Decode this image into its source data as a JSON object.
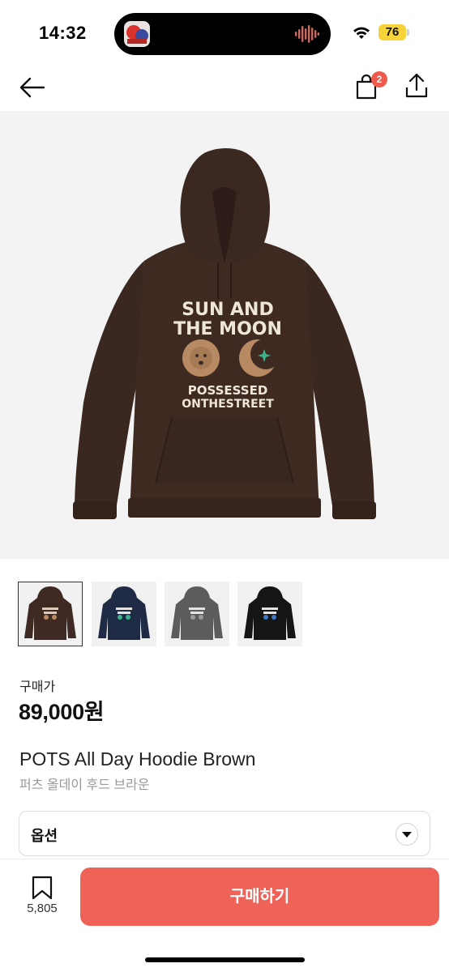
{
  "status_bar": {
    "time": "14:32",
    "battery": "76",
    "icons": [
      "app-thumbnail-icon",
      "audio-wave-icon",
      "wifi-icon",
      "battery-icon"
    ]
  },
  "nav": {
    "cart_count": "2",
    "icons": [
      "back-arrow-icon",
      "shopping-bag-icon",
      "share-icon"
    ]
  },
  "hero": {
    "print_line1": "SUN AND",
    "print_line2": "THE MOON",
    "print_line3": "POSSESSED",
    "print_line4": "ONTHESTREET",
    "hoodie_color": "#3e2a23"
  },
  "thumbnails": [
    {
      "color": "#3e2a23",
      "selected": true
    },
    {
      "color": "#1f2a44",
      "selected": false
    },
    {
      "color": "#5c5c5c",
      "selected": false
    },
    {
      "color": "#151515",
      "selected": false
    }
  ],
  "price": {
    "label": "구매가",
    "value": "89,000원"
  },
  "product": {
    "name": "POTS All Day Hoodie Brown",
    "name_ko": "퍼츠 올데이 후드 브라운"
  },
  "option": {
    "label": "옵션"
  },
  "bottom": {
    "bookmark_count": "5,805",
    "buy_label": "구매하기"
  },
  "colors": {
    "accent": "#ef6257",
    "badge": "#ef5a4e",
    "battery": "#f7d33a"
  }
}
